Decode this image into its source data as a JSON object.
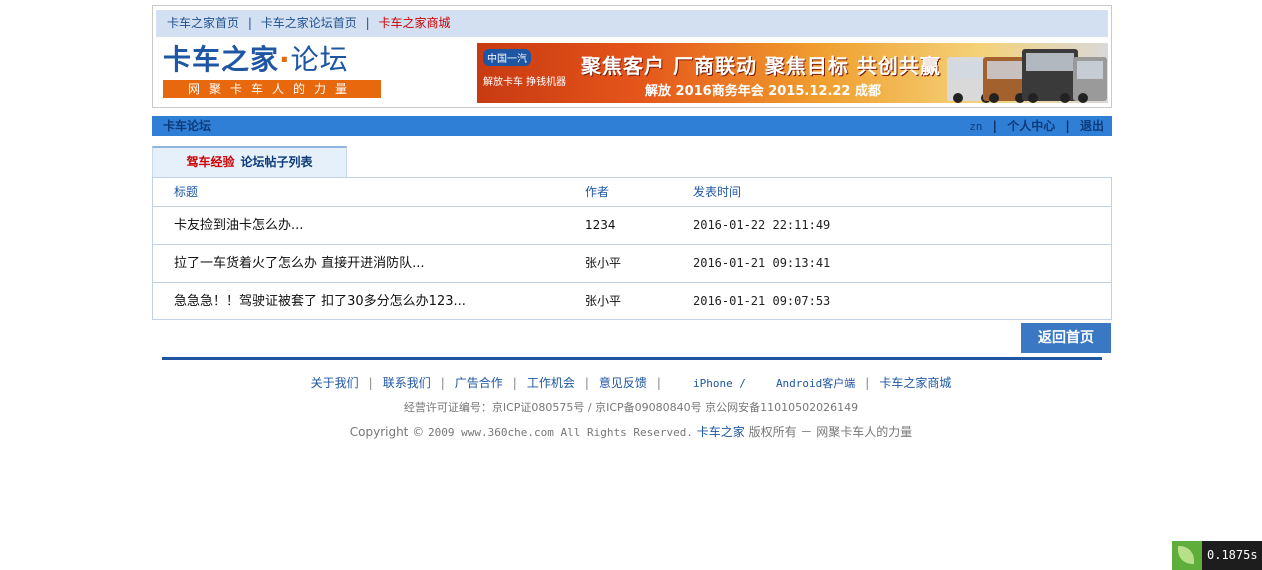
{
  "topnav": {
    "links": [
      "卡车之家首页",
      "卡车之家论坛首页",
      "卡车之家商城"
    ],
    "separator": "|"
  },
  "logo": {
    "title_main": "卡车之家",
    "title_dot": "·",
    "title_sub": "论坛",
    "slogan": "网聚卡车人的力量"
  },
  "banner": {
    "brand": "中国一汽",
    "jiefang": "解放卡车  挣钱机器",
    "headline": "聚焦客户 厂商联动 聚焦目标 共创共赢",
    "subline": "解放 2016商务年会 2015.12.22 成都"
  },
  "bluebar": {
    "title": "卡车论坛",
    "username": "zn",
    "personal_center": "个人中心",
    "logout": "退出",
    "separator": "|"
  },
  "tab": {
    "forum_name": "驾车经验",
    "label": "论坛帖子列表"
  },
  "table": {
    "headers": [
      "标题",
      "作者",
      "发表时间"
    ],
    "rows": [
      {
        "title": "卡友捡到油卡怎么办...",
        "author": "1234",
        "time": "2016-01-22 22:11:49"
      },
      {
        "title": "拉了一车货着火了怎么办 直接开进消防队...",
        "author": "张小平",
        "time": "2016-01-21 09:13:41"
      },
      {
        "title": "急急急！！驾驶证被套了 扣了30多分怎么办123...",
        "author": "张小平",
        "time": "2016-01-21 09:07:53"
      }
    ]
  },
  "back_button": "返回首页",
  "footer": {
    "links": [
      "关于我们",
      "联系我们",
      "广告合作",
      "工作机会",
      "意见反馈",
      "iPhone /",
      "Android客户端",
      "卡车之家商城"
    ],
    "separator": "|",
    "icp": "经营许可证编号：京ICP证080575号 / 京ICP备09080840号 京公网安备11010502026149",
    "copyright_prefix": "Copyright ©",
    "copyright_mono": "2009 www.360che.com All Rights Reserved.",
    "copyright_brand": "卡车之家",
    "copyright_suffix": "版权所有 － 网聚卡车人的力量"
  },
  "timer": {
    "value": "0.1875s"
  },
  "colors": {
    "brand_blue": "#1e56a3",
    "nav_bar": "#2f7fd6",
    "accent_orange": "#e8680d",
    "link_red": "#cc0000"
  }
}
